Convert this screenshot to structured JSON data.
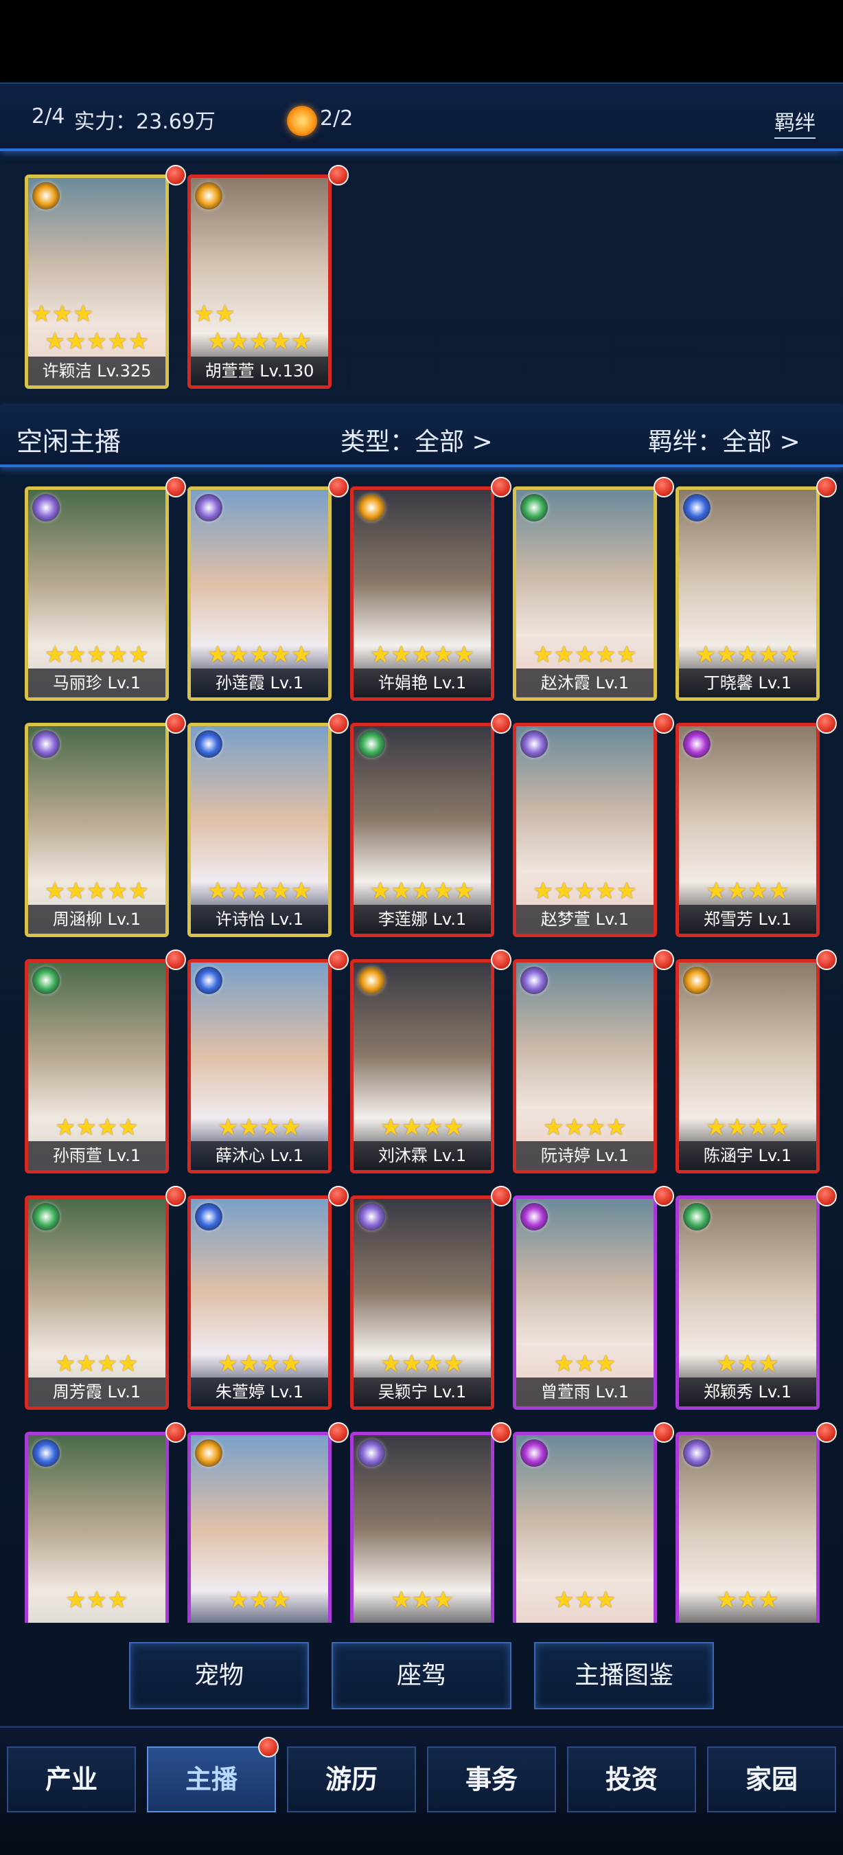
{
  "header": {
    "count": "2/4",
    "power": "实力：23.69万",
    "badge_value": "2/2",
    "bond_link": "羁绊"
  },
  "team": [
    {
      "name": "许颖洁 Lv.325",
      "stars_row1": 3,
      "stars_row2": 5,
      "border": "#d8c24a",
      "elem_color": "#f0a21a"
    },
    {
      "name": "胡萱萱 Lv.130",
      "stars_row1": 2,
      "stars_row2": 5,
      "border": "#d42a22",
      "elem_color": "#f0a21a"
    }
  ],
  "idle_section": {
    "title": "空闲主播",
    "filter_type": "类型：全部 >",
    "filter_bond": "羁绊：全部 >"
  },
  "idle_cards": [
    {
      "name": "马丽珍 Lv.1",
      "stars": 5,
      "border": "#d8c24a",
      "elem_color": "#8a6ad8"
    },
    {
      "name": "孙莲霞 Lv.1",
      "stars": 5,
      "border": "#d8c24a",
      "elem_color": "#8a6ad8"
    },
    {
      "name": "许娟艳 Lv.1",
      "stars": 5,
      "border": "#d42a22",
      "elem_color": "#f0a21a"
    },
    {
      "name": "赵沐霞 Lv.1",
      "stars": 5,
      "border": "#d8c24a",
      "elem_color": "#3fb05a"
    },
    {
      "name": "丁晓馨 Lv.1",
      "stars": 5,
      "border": "#d8c24a",
      "elem_color": "#3a6ae0"
    },
    {
      "name": "周涵柳 Lv.1",
      "stars": 5,
      "border": "#d8c24a",
      "elem_color": "#8a6ad8"
    },
    {
      "name": "许诗怡 Lv.1",
      "stars": 5,
      "border": "#d8c24a",
      "elem_color": "#3a6ae0"
    },
    {
      "name": "李莲娜 Lv.1",
      "stars": 5,
      "border": "#d42a22",
      "elem_color": "#3fb05a"
    },
    {
      "name": "赵梦萱 Lv.1",
      "stars": 5,
      "border": "#d42a22",
      "elem_color": "#8a6ad8"
    },
    {
      "name": "郑雪芳 Lv.1",
      "stars": 4,
      "border": "#d42a22",
      "elem_color": "#b03ad8"
    },
    {
      "name": "孙雨萱 Lv.1",
      "stars": 4,
      "border": "#d42a22",
      "elem_color": "#3fb05a"
    },
    {
      "name": "薛沐心 Lv.1",
      "stars": 4,
      "border": "#d42a22",
      "elem_color": "#3a6ae0"
    },
    {
      "name": "刘沐霖 Lv.1",
      "stars": 4,
      "border": "#d42a22",
      "elem_color": "#f0a21a"
    },
    {
      "name": "阮诗婷 Lv.1",
      "stars": 4,
      "border": "#d42a22",
      "elem_color": "#8a6ad8"
    },
    {
      "name": "陈涵宇 Lv.1",
      "stars": 4,
      "border": "#d42a22",
      "elem_color": "#f0a21a"
    },
    {
      "name": "周芳霞 Lv.1",
      "stars": 4,
      "border": "#d42a22",
      "elem_color": "#3fb05a"
    },
    {
      "name": "朱萱婷 Lv.1",
      "stars": 4,
      "border": "#d42a22",
      "elem_color": "#3a6ae0"
    },
    {
      "name": "吴颖宁 Lv.1",
      "stars": 4,
      "border": "#d42a22",
      "elem_color": "#8a6ad8"
    },
    {
      "name": "曾萱雨 Lv.1",
      "stars": 3,
      "border": "#a83ad8",
      "elem_color": "#b03ad8"
    },
    {
      "name": "郑颖秀 Lv.1",
      "stars": 3,
      "border": "#a83ad8",
      "elem_color": "#3fb05a"
    },
    {
      "name": "",
      "stars": 3,
      "border": "#a83ad8",
      "elem_color": "#3a6ae0"
    },
    {
      "name": "",
      "stars": 3,
      "border": "#a83ad8",
      "elem_color": "#f0a21a"
    },
    {
      "name": "",
      "stars": 3,
      "border": "#a83ad8",
      "elem_color": "#8a6ad8"
    },
    {
      "name": "",
      "stars": 3,
      "border": "#a83ad8",
      "elem_color": "#b03ad8"
    },
    {
      "name": "",
      "stars": 3,
      "border": "#a83ad8",
      "elem_color": "#8a6ad8"
    }
  ],
  "bottom_buttons": [
    "宠物",
    "座驾",
    "主播图鉴"
  ],
  "tabs": [
    {
      "label": "产业",
      "active": false
    },
    {
      "label": "主播",
      "active": true
    },
    {
      "label": "游历",
      "active": false
    },
    {
      "label": "事务",
      "active": false
    },
    {
      "label": "投资",
      "active": false
    },
    {
      "label": "家园",
      "active": false
    }
  ]
}
